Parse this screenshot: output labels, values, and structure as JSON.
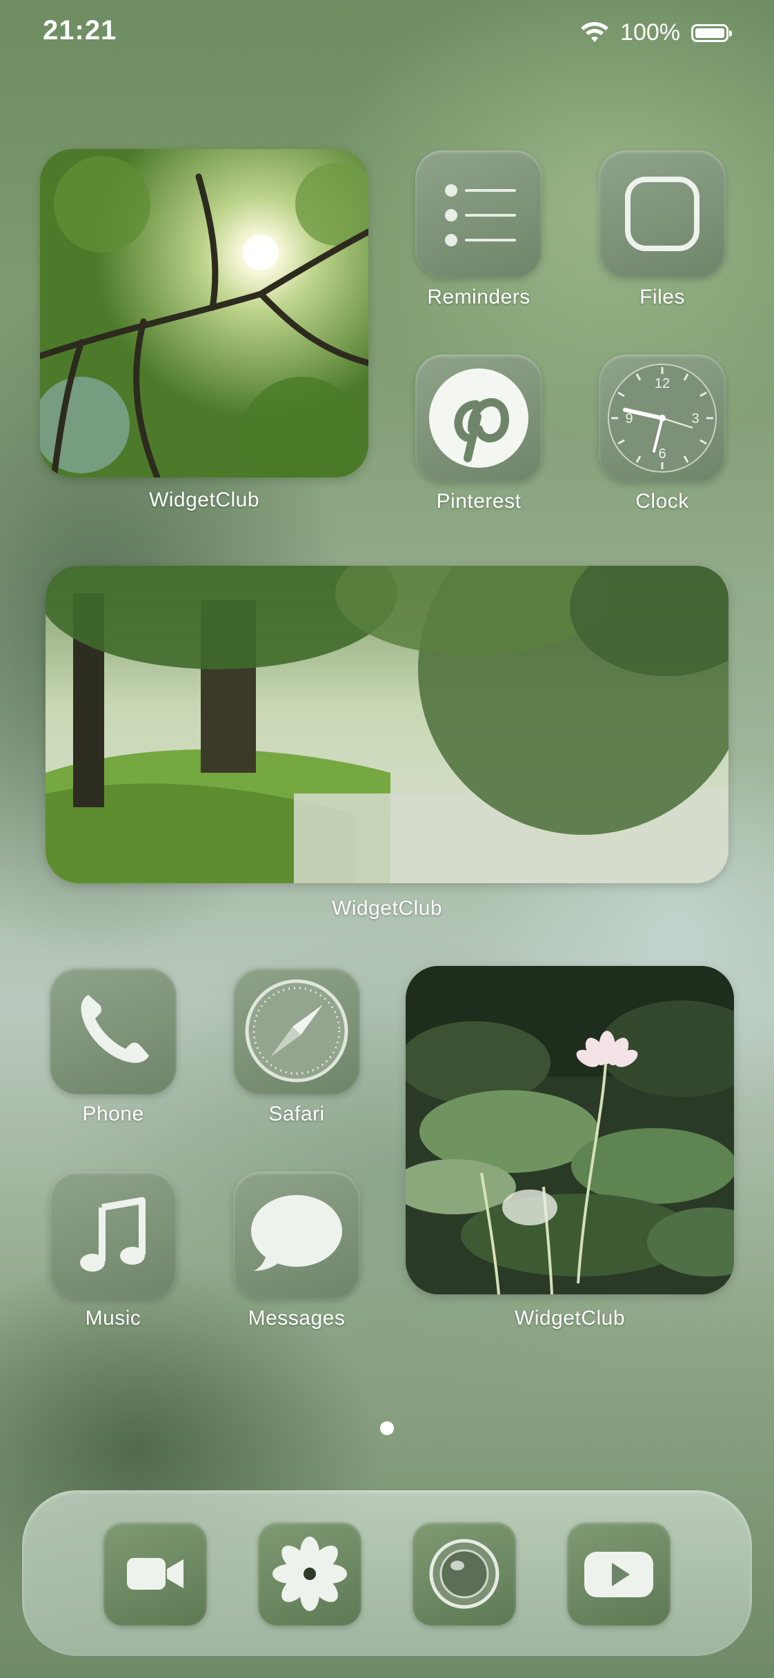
{
  "status_bar": {
    "time": "21:21",
    "battery_percent": "100%"
  },
  "widgets": [
    {
      "label": "WidgetClub",
      "scene": "sunlit tree canopy"
    },
    {
      "label": "WidgetClub",
      "scene": "trees over pond"
    },
    {
      "label": "WidgetClub",
      "scene": "lotus flower"
    }
  ],
  "apps": {
    "reminders": "Reminders",
    "files": "Files",
    "pinterest": "Pinterest",
    "clock": "Clock",
    "phone": "Phone",
    "safari": "Safari",
    "music": "Music",
    "messages": "Messages"
  },
  "clock_face": {
    "n12": "12",
    "n3": "3",
    "n6": "6",
    "n9": "9"
  },
  "dock": {
    "apps": [
      "facetime-icon",
      "photos-icon",
      "camera-icon",
      "youtube-icon"
    ]
  },
  "page_indicator": {
    "pages": 1,
    "current": 1
  },
  "colors": {
    "icon_tint": "#7a9074",
    "text": "#ffffff"
  }
}
